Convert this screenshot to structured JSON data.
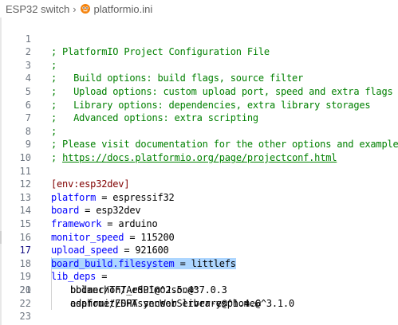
{
  "breadcrumb": {
    "folder": "ESP32 switch",
    "separator": "›",
    "file": "platformio.ini",
    "file_icon": "platformio-alien-icon",
    "file_icon_color": "#f5820b"
  },
  "editor": {
    "active_line": 17,
    "lines": [
      {
        "n": "1",
        "text": "; PlatformIO Project Configuration File"
      },
      {
        "n": "2",
        "text": ";"
      },
      {
        "n": "3",
        "text": ";   Build options: build flags, source filter"
      },
      {
        "n": "4",
        "text": ";   Upload options: custom upload port, speed and extra flags"
      },
      {
        "n": "5",
        "text": ";   Library options: dependencies, extra library storages"
      },
      {
        "n": "6",
        "text": ";   Advanced options: extra scripting"
      },
      {
        "n": "7",
        "text": ";"
      },
      {
        "n": "8",
        "text": "; Please visit documentation for the other options and examples"
      },
      {
        "n": "9",
        "prefix": "; ",
        "link": "https://docs.platformio.org/page/projectconf.html"
      },
      {
        "n": "10",
        "text": ""
      },
      {
        "n": "11",
        "text": "[env:esp32dev]"
      },
      {
        "n": "12",
        "key": "platform",
        "eq": " = ",
        "value": "espressif32"
      },
      {
        "n": "13",
        "key": "board",
        "eq": " = ",
        "value": "esp32dev"
      },
      {
        "n": "14",
        "key": "framework",
        "eq": " = ",
        "value": "arduino"
      },
      {
        "n": "15",
        "key": "monitor_speed",
        "eq": " = ",
        "value": "115200"
      },
      {
        "n": "16",
        "key": "upload_speed",
        "eq": " = ",
        "value": "921600"
      },
      {
        "n": "17",
        "key": "board_build.filesystem",
        "eq": " = ",
        "value": "littlefs"
      },
      {
        "n": "18",
        "key": "lib_deps",
        "eq": " =",
        "value": ""
      },
      {
        "n": "19",
        "text": "bodmer/TFT_eSPI@^2.5.43"
      },
      {
        "n": "20",
        "text": "esphome/ESPAsyncWebServer-esphome@^3.1.0"
      },
      {
        "n": "21",
        "text": "bblanchon/ArduinoJson@^7.0.3"
      },
      {
        "n": "22",
        "text": "adafruit/DHT sensor library@^1.4.6"
      },
      {
        "n": "23",
        "text": ""
      }
    ]
  },
  "colors": {
    "comment": "#008000",
    "section": "#800000",
    "key": "#0000ff",
    "selection": "#add6ff"
  }
}
